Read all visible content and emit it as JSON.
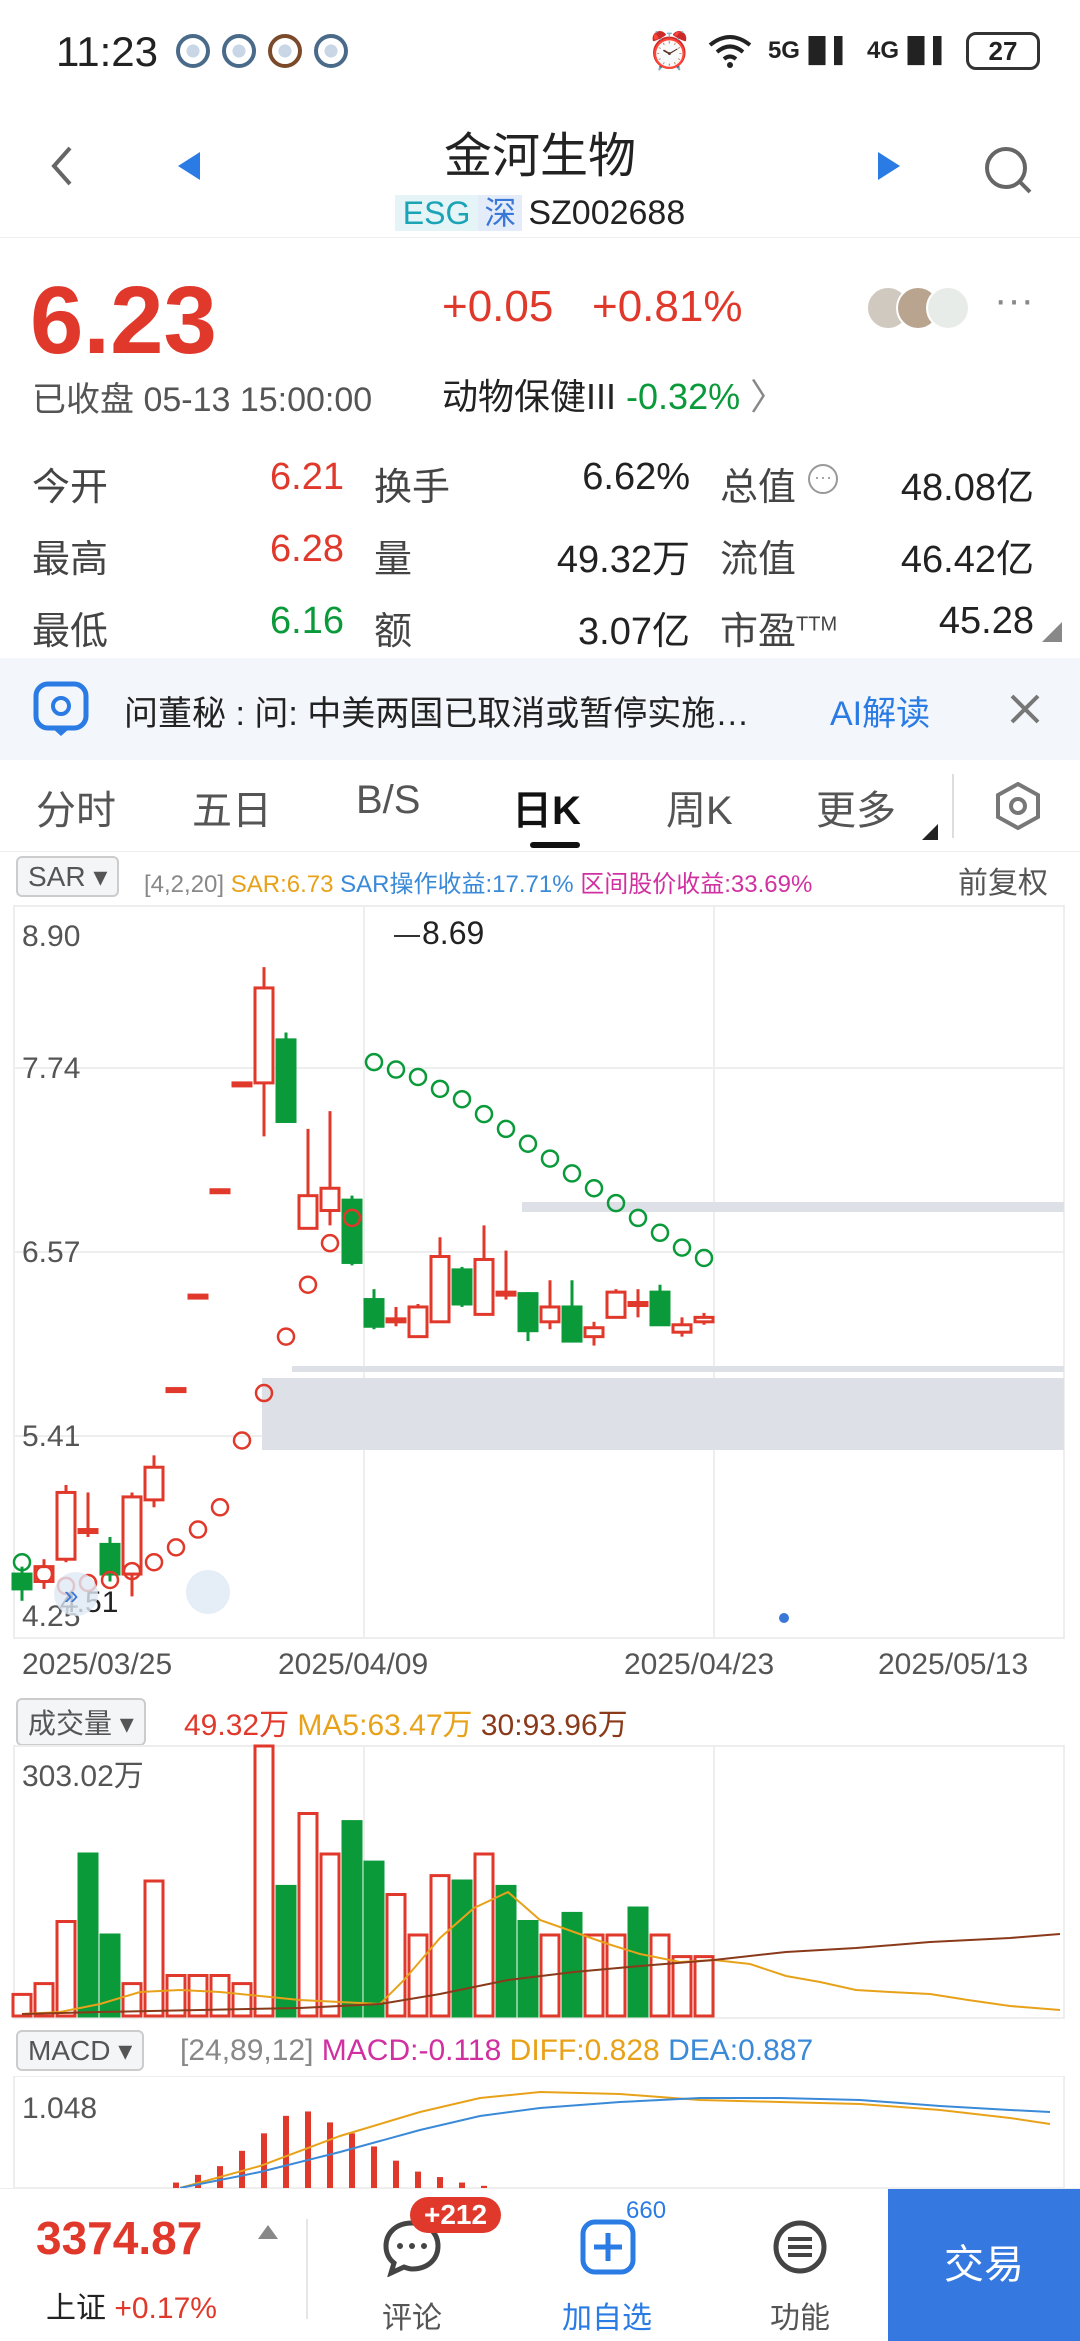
{
  "status_bar": {
    "time": "11:23",
    "net1": "5G",
    "net2": "4G",
    "battery": "27"
  },
  "header": {
    "title": "金河生物",
    "tag_esg": "ESG",
    "tag_market": "深",
    "code": "SZ002688"
  },
  "quote": {
    "price": "6.23",
    "change": "+0.05",
    "change_pct": "+0.81%",
    "status": "已收盘 05-13 15:00:00",
    "sector_name": "动物保健III",
    "sector_change": "-0.32%"
  },
  "stats": [
    {
      "label": "今开",
      "value": "6.21",
      "color": "#e0392b"
    },
    {
      "label": "换手",
      "value": "6.62%",
      "color": "#222222"
    },
    {
      "label": "总值",
      "value": "48.08亿",
      "color": "#222222"
    },
    {
      "label": "最高",
      "value": "6.28",
      "color": "#e0392b"
    },
    {
      "label": "量",
      "value": "49.32万",
      "color": "#222222"
    },
    {
      "label": "流值",
      "value": "46.42亿",
      "color": "#222222"
    },
    {
      "label": "最低",
      "value": "6.16",
      "color": "#0a9a3a"
    },
    {
      "label": "额",
      "value": "3.07亿",
      "color": "#222222"
    },
    {
      "label": "市盈",
      "value": "45.28",
      "color": "#222222"
    }
  ],
  "pe_sup": "TTM",
  "banner": {
    "text": "问董秘 : 问:  中美两国已取消或暂停实施…",
    "ai": "AI解读"
  },
  "tabs": [
    {
      "label": "分时"
    },
    {
      "label": "五日"
    },
    {
      "label": "B/S"
    },
    {
      "label": "日K"
    },
    {
      "label": "周K"
    },
    {
      "label": "更多"
    }
  ],
  "sar_row": {
    "selector": "SAR",
    "params": "[4,2,20]",
    "sar": "SAR:6.73",
    "profit": "SAR操作收益:17.71%",
    "range": "区间股价收益:33.69%",
    "adjust": "前复权"
  },
  "vol_row": {
    "selector": "成交量",
    "vol": "49.32万",
    "ma5": "MA5:63.47万",
    "ma30": "30:93.96万",
    "vol_axis_max": "303.02万"
  },
  "macd_row": {
    "selector": "MACD",
    "params": "[24,89,12]",
    "macd": "MACD:-0.118",
    "diff": "DIFF:0.828",
    "dea": "DEA:0.887",
    "axis_max": "1.048"
  },
  "chart_labels": {
    "y1": "8.90",
    "y2": "7.74",
    "y3": "6.57",
    "y4": "5.41",
    "y5": "4.25",
    "high": "8.69",
    "low": "4.51",
    "dates": [
      "2025/03/25",
      "2025/04/09",
      "2025/04/23",
      "2025/05/13"
    ]
  },
  "chart_data": {
    "type": "candlestick",
    "ylim": [
      4.25,
      8.9
    ],
    "candles": [
      {
        "o": 4.6,
        "c": 4.5,
        "h": 4.65,
        "l": 4.42
      },
      {
        "o": 4.55,
        "c": 4.65,
        "h": 4.7,
        "l": 4.5
      },
      {
        "o": 4.7,
        "c": 5.15,
        "h": 5.2,
        "l": 4.68
      },
      {
        "o": 4.9,
        "c": 4.9,
        "h": 5.15,
        "l": 4.85
      },
      {
        "o": 4.8,
        "c": 4.6,
        "h": 4.85,
        "l": 4.55
      },
      {
        "o": 4.6,
        "c": 5.12,
        "h": 5.15,
        "l": 4.45
      },
      {
        "o": 5.1,
        "c": 5.32,
        "h": 5.4,
        "l": 5.05
      },
      {
        "o": 5.85,
        "c": 5.85,
        "h": 5.85,
        "l": 5.85
      },
      {
        "o": 6.48,
        "c": 6.48,
        "h": 6.48,
        "l": 6.48
      },
      {
        "o": 7.19,
        "c": 7.19,
        "h": 7.19,
        "l": 7.19
      },
      {
        "o": 7.91,
        "c": 7.91,
        "h": 7.91,
        "l": 7.91
      },
      {
        "o": 7.91,
        "c": 8.55,
        "h": 8.69,
        "l": 7.55
      },
      {
        "o": 8.2,
        "c": 7.65,
        "h": 8.25,
        "l": 7.65
      },
      {
        "o": 6.93,
        "c": 7.15,
        "h": 7.6,
        "l": 6.93
      },
      {
        "o": 7.05,
        "c": 7.2,
        "h": 7.72,
        "l": 6.95
      },
      {
        "o": 7.12,
        "c": 6.7,
        "h": 7.15,
        "l": 6.68
      },
      {
        "o": 6.45,
        "c": 6.27,
        "h": 6.52,
        "l": 6.25
      },
      {
        "o": 6.32,
        "c": 6.32,
        "h": 6.4,
        "l": 6.27
      },
      {
        "o": 6.2,
        "c": 6.4,
        "h": 6.42,
        "l": 6.2
      },
      {
        "o": 6.3,
        "c": 6.74,
        "h": 6.87,
        "l": 6.3
      },
      {
        "o": 6.65,
        "c": 6.42,
        "h": 6.67,
        "l": 6.4
      },
      {
        "o": 6.35,
        "c": 6.72,
        "h": 6.95,
        "l": 6.35
      },
      {
        "o": 6.5,
        "c": 6.5,
        "h": 6.78,
        "l": 6.45
      },
      {
        "o": 6.49,
        "c": 6.24,
        "h": 6.5,
        "l": 6.17
      },
      {
        "o": 6.3,
        "c": 6.4,
        "h": 6.58,
        "l": 6.25
      },
      {
        "o": 6.4,
        "c": 6.17,
        "h": 6.58,
        "l": 6.17
      },
      {
        "o": 6.2,
        "c": 6.26,
        "h": 6.3,
        "l": 6.14
      },
      {
        "o": 6.33,
        "c": 6.5,
        "h": 6.52,
        "l": 6.33
      },
      {
        "o": 6.43,
        "c": 6.43,
        "h": 6.52,
        "l": 6.33
      },
      {
        "o": 6.5,
        "c": 6.28,
        "h": 6.55,
        "l": 6.28
      },
      {
        "o": 6.23,
        "c": 6.28,
        "h": 6.33,
        "l": 6.2
      },
      {
        "o": 6.3,
        "c": 6.33,
        "h": 6.36,
        "l": 6.28
      }
    ],
    "sar": [
      4.68,
      4.6,
      4.52,
      4.54,
      4.56,
      4.62,
      4.68,
      4.78,
      4.9,
      5.05,
      5.5,
      5.82,
      6.2,
      6.55,
      6.83,
      7.0,
      8.05,
      8.0,
      7.95,
      7.87,
      7.8,
      7.7,
      7.6,
      7.5,
      7.4,
      7.3,
      7.2,
      7.1,
      7.0,
      6.9,
      6.8,
      6.73
    ],
    "volume": [
      0.08,
      0.12,
      0.35,
      0.6,
      0.3,
      0.12,
      0.5,
      0.15,
      0.15,
      0.15,
      0.12,
      1.0,
      0.48,
      0.75,
      0.6,
      0.72,
      0.57,
      0.45,
      0.3,
      0.52,
      0.5,
      0.6,
      0.48,
      0.35,
      0.3,
      0.38,
      0.3,
      0.3,
      0.4,
      0.3,
      0.22,
      0.22
    ],
    "volume_up": [
      true,
      true,
      true,
      false,
      false,
      true,
      true,
      true,
      true,
      true,
      true,
      true,
      false,
      true,
      true,
      false,
      false,
      true,
      true,
      true,
      false,
      true,
      false,
      false,
      true,
      false,
      true,
      true,
      false,
      true,
      true,
      true
    ],
    "macd_bars": [
      0.0,
      0.0,
      0.0,
      0.0,
      0.0,
      0.0,
      0.0,
      0.05,
      0.12,
      0.2,
      0.34,
      0.5,
      0.66,
      0.7,
      0.6,
      0.5,
      0.38,
      0.25,
      0.15,
      0.1,
      0.05,
      0.02
    ]
  },
  "bottom": {
    "index_value": "3374.87",
    "index_name": "上证",
    "index_change": "+0.17%",
    "comment_badge": "+212",
    "comment": "评论",
    "watch_badge": "660",
    "watch": "加自选",
    "func": "功能",
    "trade": "交易"
  }
}
